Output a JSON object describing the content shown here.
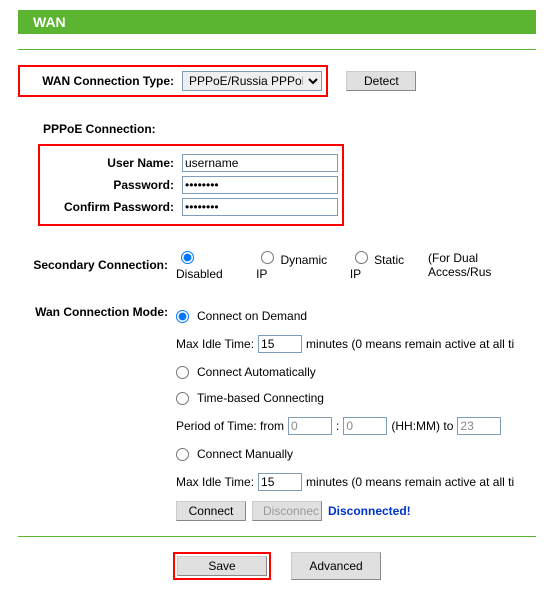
{
  "header": {
    "title": "WAN"
  },
  "connType": {
    "label": "WAN Connection Type:",
    "selected": "PPPoE/Russia PPPoE",
    "detect": "Detect"
  },
  "pppoe": {
    "heading": "PPPoE Connection:",
    "username_label": "User Name:",
    "username_value": "username",
    "password_label": "Password:",
    "password_value": "password",
    "confirm_label": "Confirm Password:",
    "confirm_value": "password"
  },
  "secondary": {
    "label": "Secondary Connection:",
    "disabled": "Disabled",
    "dynamic": "Dynamic IP",
    "static": "Static IP",
    "note": "(For Dual Access/Rus"
  },
  "mode": {
    "label": "Wan Connection Mode:",
    "on_demand": "Connect on Demand",
    "idle_label": "Max Idle Time:",
    "idle_value1": "15",
    "idle_note": "minutes (0 means remain active at all ti",
    "auto": "Connect Automatically",
    "time_based": "Time-based Connecting",
    "period_label": "Period of Time: from",
    "period_from": "0",
    "colon": ":",
    "period_to": "0",
    "hhmm_to": "(HH:MM) to",
    "period_end": "23",
    "manual": "Connect Manually",
    "idle_value2": "15",
    "connect": "Connect",
    "disconnect": "Disconnec",
    "status": "Disconnected!"
  },
  "footer": {
    "save": "Save",
    "advanced": "Advanced"
  }
}
